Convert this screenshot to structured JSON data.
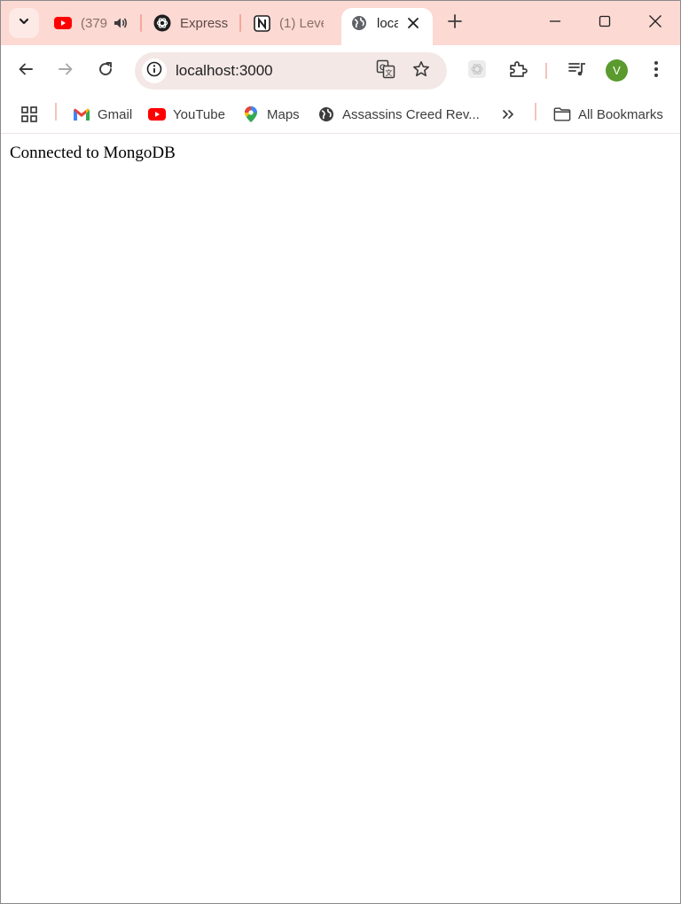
{
  "tabs": [
    {
      "title": "(379",
      "icon": "youtube-icon"
    },
    {
      "title": "Express",
      "icon": "openai-icon"
    },
    {
      "title": "(1) Leve",
      "icon": "notion-icon"
    },
    {
      "title": "loca",
      "icon": "globe-icon",
      "active": true
    }
  ],
  "toolbar": {
    "url": "localhost:3000",
    "avatar_letter": "V"
  },
  "bookmarks": [
    {
      "label": "Gmail",
      "icon": "gmail-icon"
    },
    {
      "label": "YouTube",
      "icon": "youtube-icon"
    },
    {
      "label": "Maps",
      "icon": "maps-icon"
    },
    {
      "label": "Assassins Creed Rev...",
      "icon": "globe-icon"
    }
  ],
  "all_bookmarks_label": "All Bookmarks",
  "page": {
    "message": "Connected to MongoDB"
  },
  "colors": {
    "tabstrip": "#fcd9d3",
    "omnibox": "#f3e8e6",
    "avatar": "#5a9a2e",
    "youtube_red": "#ff0000"
  }
}
